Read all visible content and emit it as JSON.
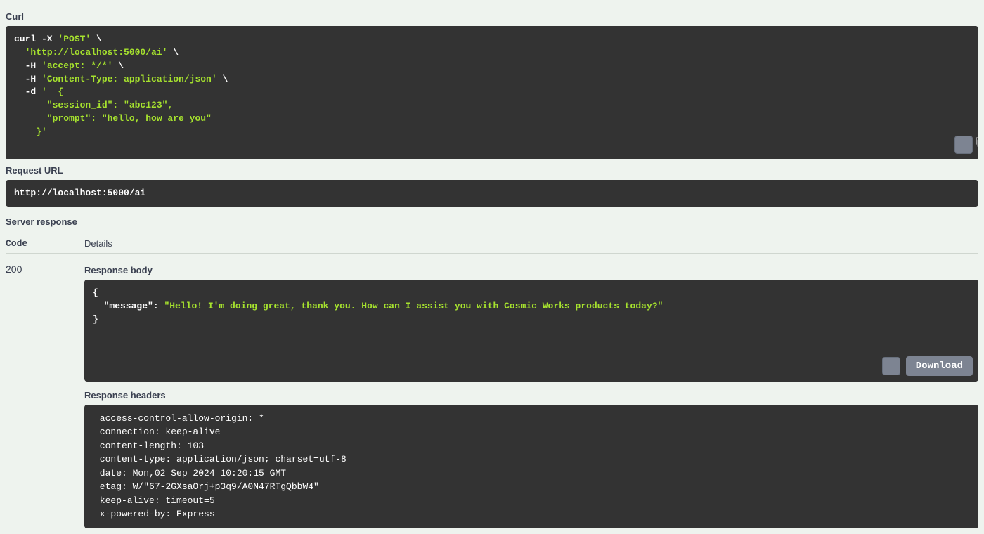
{
  "labels": {
    "curl": "Curl",
    "request_url": "Request URL",
    "server_response": "Server response",
    "code": "Code",
    "details": "Details",
    "response_body": "Response body",
    "response_headers": "Response headers",
    "download": "Download"
  },
  "curl": {
    "line1a": "curl -X ",
    "line1b": "'POST'",
    "line1c": " \\",
    "line2a": "  ",
    "line2b": "'http://localhost:5000/ai'",
    "line2c": " \\",
    "line3a": "  -H ",
    "line3b": "'accept: */*'",
    "line3c": " \\",
    "line4a": "  -H ",
    "line4b": "'Content-Type: application/json'",
    "line4c": " \\",
    "line5a": "  -d ",
    "line5b": "'  {",
    "line6": "      \"session_id\": \"abc123\",",
    "line7": "      \"prompt\": \"hello, how are you\"",
    "line8": "    }'"
  },
  "request_url": "http://localhost:5000/ai",
  "response": {
    "code": "200",
    "body_open": "{",
    "body_key": "  \"message\"",
    "body_colon": ": ",
    "body_value": "\"Hello! I'm doing great, thank you. How can I assist you with Cosmic Works products today?\"",
    "body_close": "}",
    "headers": " access-control-allow-origin: * \n connection: keep-alive \n content-length: 103 \n content-type: application/json; charset=utf-8 \n date: Mon,02 Sep 2024 10:20:15 GMT \n etag: W/\"67-2GXsaOrj+p3q9/A0N47RTgQbbW4\" \n keep-alive: timeout=5 \n x-powered-by: Express "
  }
}
